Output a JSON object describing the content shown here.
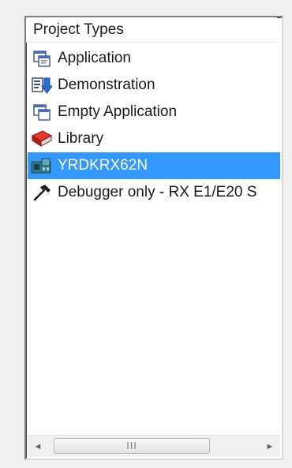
{
  "panel": {
    "header": "Project Types",
    "items": [
      {
        "label": "Application",
        "icon": "application-icon",
        "selected": false
      },
      {
        "label": "Demonstration",
        "icon": "demonstration-icon",
        "selected": false
      },
      {
        "label": "Empty Application",
        "icon": "empty-application-icon",
        "selected": false
      },
      {
        "label": "Library",
        "icon": "library-book-icon",
        "selected": false
      },
      {
        "label": "YRDKRX62N",
        "icon": "board-icon",
        "selected": true
      },
      {
        "label": "Debugger only - RX E1/E20 S",
        "icon": "hammer-icon",
        "selected": false
      }
    ]
  },
  "scrollbar": {
    "grip": "III",
    "left_arrow": "◄",
    "right_arrow": "►"
  },
  "colors": {
    "selection": "#3399ff",
    "background": "#ffffff",
    "window": "#f0f0f0"
  }
}
